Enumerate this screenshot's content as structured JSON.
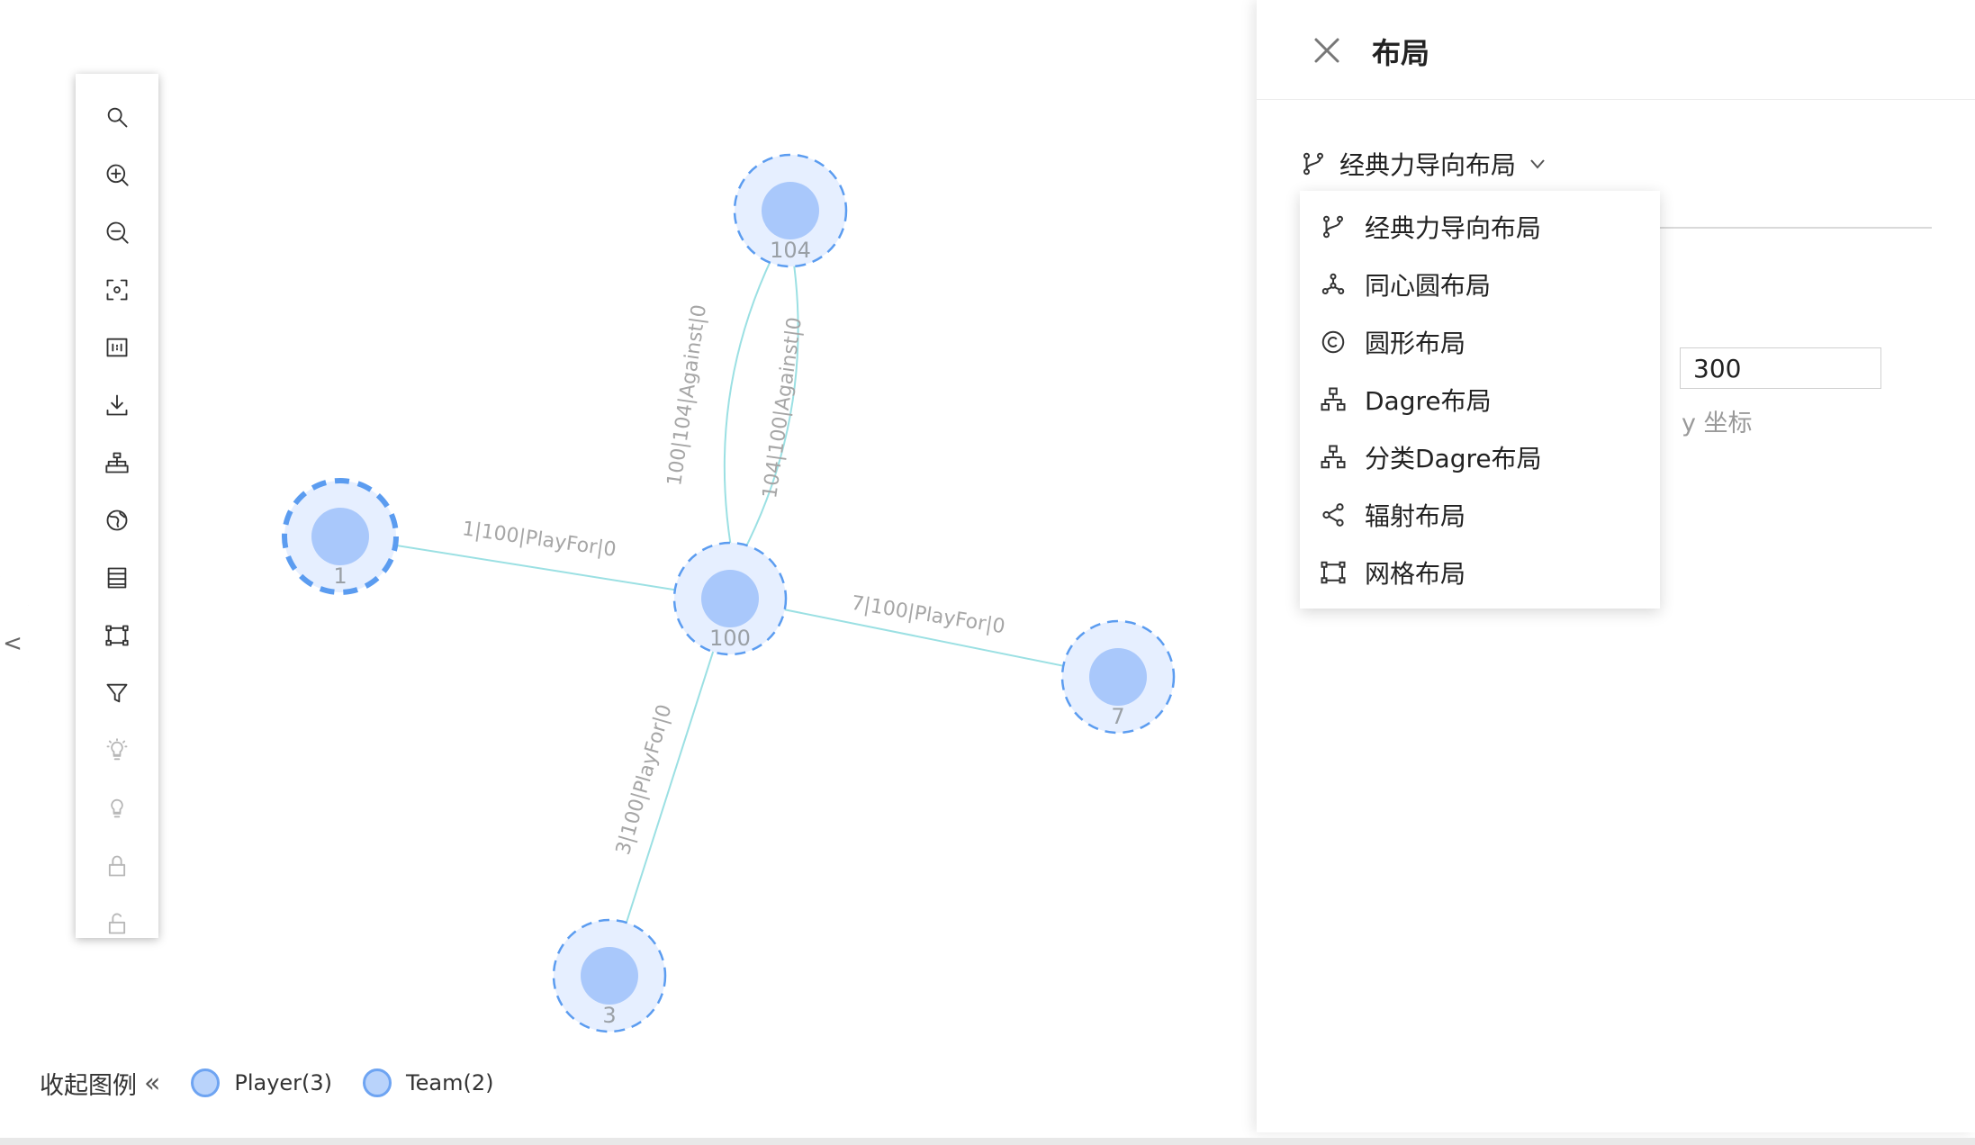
{
  "graph": {
    "nodes": [
      {
        "id": "n104",
        "label": "104",
        "type": "Team"
      },
      {
        "id": "n1",
        "label": "1",
        "type": "Player"
      },
      {
        "id": "n100",
        "label": "100",
        "type": "Team"
      },
      {
        "id": "n7",
        "label": "7",
        "type": "Player"
      },
      {
        "id": "n3",
        "label": "3",
        "type": "Player"
      }
    ],
    "edges": [
      {
        "id": "e1",
        "source": "n1",
        "target": "n100",
        "label": "1|100|PlayFor|0"
      },
      {
        "id": "e2",
        "source": "n7",
        "target": "n100",
        "label": "7|100|PlayFor|0"
      },
      {
        "id": "e3",
        "source": "n3",
        "target": "n100",
        "label": "3|100|PlayFor|0"
      },
      {
        "id": "e4",
        "source": "n104",
        "target": "n100",
        "label": "100|104|Against|0"
      },
      {
        "id": "e5",
        "source": "n104",
        "target": "n100",
        "label": "104|100|Against|0"
      }
    ]
  },
  "toolbar": {
    "items": [
      {
        "icon": "search-icon",
        "enabled": true
      },
      {
        "icon": "zoom-in-icon",
        "enabled": true
      },
      {
        "icon": "zoom-out-icon",
        "enabled": true
      },
      {
        "icon": "focus-fit-icon",
        "enabled": true
      },
      {
        "icon": "actual-size-icon",
        "enabled": true
      },
      {
        "icon": "download-icon",
        "enabled": true
      },
      {
        "icon": "hierarchy-icon",
        "enabled": true
      },
      {
        "icon": "globe-icon",
        "enabled": true
      },
      {
        "icon": "list-icon",
        "enabled": true
      },
      {
        "icon": "grid-layout-icon",
        "enabled": true
      },
      {
        "icon": "filter-icon",
        "enabled": true
      },
      {
        "icon": "highlight-bulb-icon",
        "enabled": false
      },
      {
        "icon": "bulb-off-icon",
        "enabled": false
      },
      {
        "icon": "lock-icon",
        "enabled": false
      },
      {
        "icon": "unlock-icon",
        "enabled": false
      }
    ]
  },
  "legend": {
    "collapse_text": "收起图例",
    "collapse_icon": "«",
    "items": [
      {
        "label": "Player(3)"
      },
      {
        "label": "Team(2)"
      }
    ]
  },
  "panel": {
    "title": "布局",
    "selected_layout": "经典力导向布局",
    "y_value": "300",
    "y_caption": "y 坐标"
  },
  "dropdown": {
    "options": [
      {
        "label": "经典力导向布局",
        "icon": "branch-icon"
      },
      {
        "label": "同心圆布局",
        "icon": "concentric-icon"
      },
      {
        "label": "圆形布局",
        "icon": "circle-c-icon"
      },
      {
        "label": "Dagre布局",
        "icon": "dagre-tree-icon"
      },
      {
        "label": "分类Dagre布局",
        "icon": "category-dagre-icon"
      },
      {
        "label": "辐射布局",
        "icon": "radial-share-icon"
      },
      {
        "label": "网格布局",
        "icon": "grid-frame-icon"
      }
    ]
  },
  "colors": {
    "node_fill": "#a9c8fb",
    "node_halo": "#e6efff",
    "node_border": "#5b9cf0",
    "edge": "#9be0e3"
  }
}
